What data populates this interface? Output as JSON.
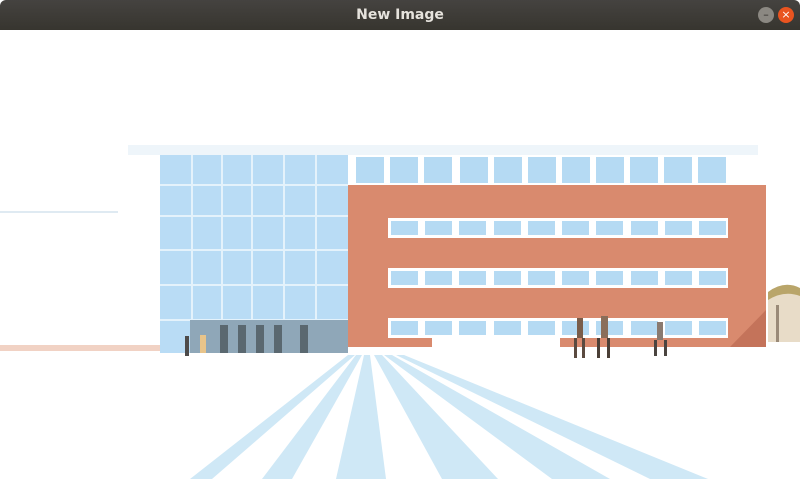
{
  "window": {
    "title": "New Image",
    "minimize_icon": "minimize-icon",
    "close_icon": "close-icon",
    "minimize_glyph": "–",
    "close_glyph": "×",
    "close_color": "#e95420",
    "titlebar_color": "#3c3b37"
  },
  "image": {
    "content": "photo-building",
    "palette": {
      "sky": "#ffffff",
      "brick": "#d98a6e",
      "glass": "#a9d2f2",
      "steps": "#cfe8f6"
    }
  }
}
